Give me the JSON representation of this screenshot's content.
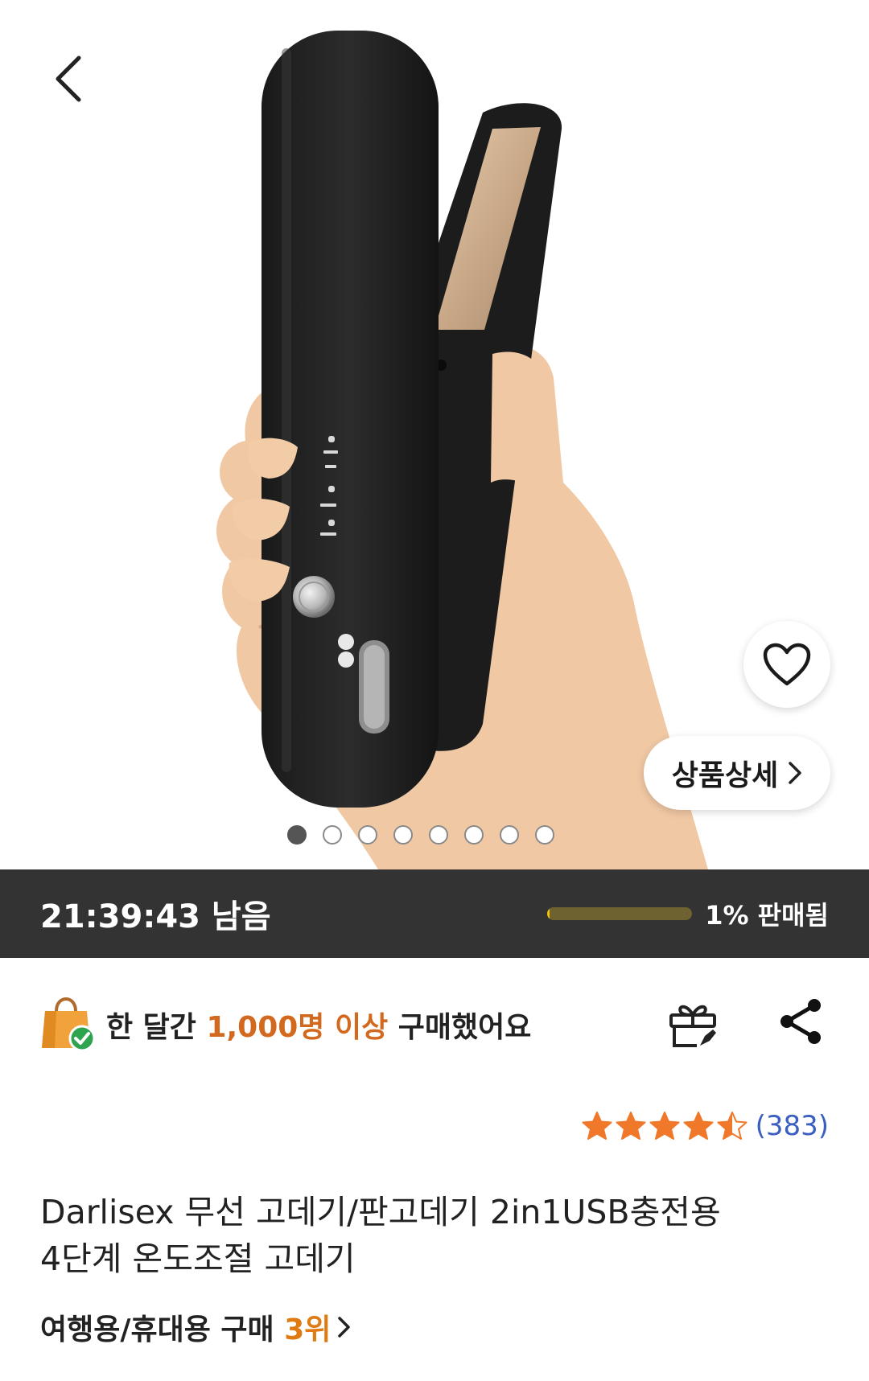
{
  "hero": {
    "image_label": "product-photo-wireless-hair-straightener",
    "icons": {
      "back": "chevron-left-icon",
      "wish": "heart-outline-icon",
      "detail": "chevron-right-icon"
    },
    "detail_button_label": "상품상세",
    "carousel": {
      "total": 8,
      "active_index": 0
    }
  },
  "timer": {
    "remaining_label": "21:39:43 남음",
    "sold_fraction": 0.01,
    "sold_label": "1% 판매됨",
    "colors": {
      "bar_bg": "#333333",
      "progress_fill": "#f2c200",
      "progress_track": "#6e6330"
    }
  },
  "proof": {
    "icon": "shopping-bag-check-icon",
    "prefix": "한 달간 ",
    "highlight": "1,000명 이상",
    "suffix": " 구매했어요",
    "highlight_color": "#d2691e"
  },
  "actions": {
    "gift_icon": "gift-icon",
    "share_icon": "share-icon"
  },
  "rating": {
    "stars": 4.5,
    "max_stars": 5,
    "star_color": "#f0782a",
    "review_count": "(383)"
  },
  "product": {
    "title_line1": "Darlisex 무선 고데기/판고데기 2in1USB충전용",
    "title_line2": "4단계 온도조절 고데기",
    "rank_prefix": "여행용/휴대용 구매 ",
    "rank_value": "3위",
    "rank_icon": "chevron-right-icon"
  }
}
